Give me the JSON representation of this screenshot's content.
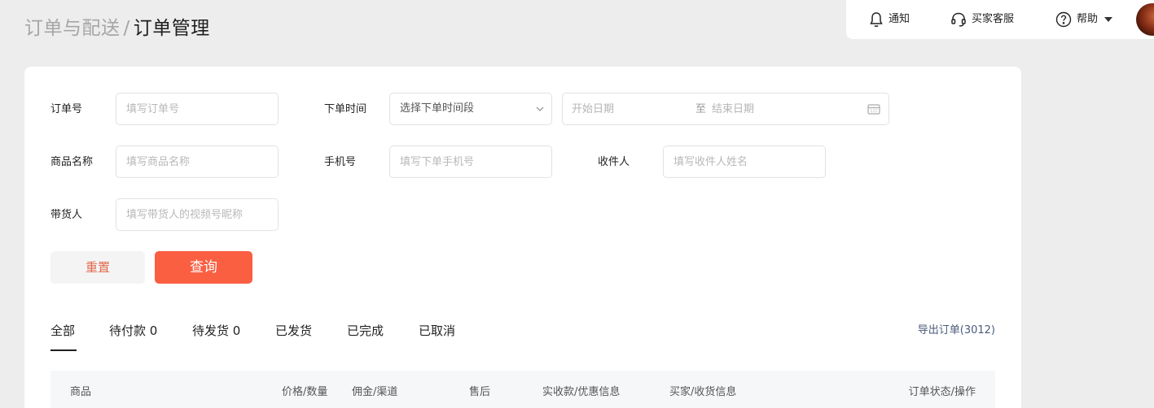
{
  "breadcrumb": {
    "parent": "订单与配送",
    "separator": "/",
    "current": "订单管理"
  },
  "topbar": {
    "notify": "通知",
    "service": "买家客服",
    "help": "帮助"
  },
  "filters": {
    "order_no": {
      "label": "订单号",
      "placeholder": "填写订单号"
    },
    "order_time": {
      "label": "下单时间",
      "select_value": "选择下单时间段",
      "start_placeholder": "开始日期",
      "to": "至",
      "end_placeholder": "结束日期"
    },
    "product_name": {
      "label": "商品名称",
      "placeholder": "填写商品名称"
    },
    "phone": {
      "label": "手机号",
      "placeholder": "填写下单手机号"
    },
    "receiver": {
      "label": "收件人",
      "placeholder": "填写收件人姓名"
    },
    "promoter": {
      "label": "带货人",
      "placeholder": "填写带货人的视频号昵称"
    }
  },
  "buttons": {
    "reset": "重置",
    "query": "查询"
  },
  "tabs": [
    "全部",
    "待付款 0",
    "待发货 0",
    "已发货",
    "已完成",
    "已取消"
  ],
  "export": "导出订单(3012)",
  "table": {
    "columns": [
      "商品",
      "价格/数量",
      "佣金/渠道",
      "售后",
      "实收款/优惠信息",
      "买家/收货信息",
      "订单状态/操作"
    ]
  },
  "colors": {
    "accent": "#fa5f42",
    "reset_text": "#e26a4f"
  }
}
